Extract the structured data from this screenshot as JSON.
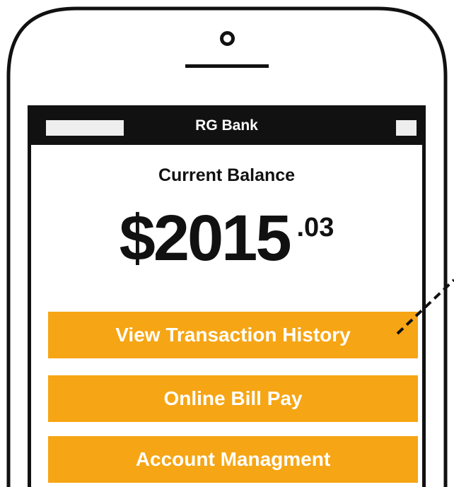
{
  "app": {
    "title": "RG Bank"
  },
  "balance": {
    "label": "Current Balance",
    "dollars": "$2015",
    "cents": ".03"
  },
  "menu": {
    "items": [
      {
        "label": "View Transaction History"
      },
      {
        "label": "Online Bill Pay"
      },
      {
        "label": "Account Managment"
      }
    ]
  },
  "colors": {
    "accent": "#f6a514",
    "frame": "#111111",
    "status_placeholder": "#eeeeee"
  },
  "icons": {
    "camera": "camera-icon",
    "speaker": "speaker-icon"
  }
}
